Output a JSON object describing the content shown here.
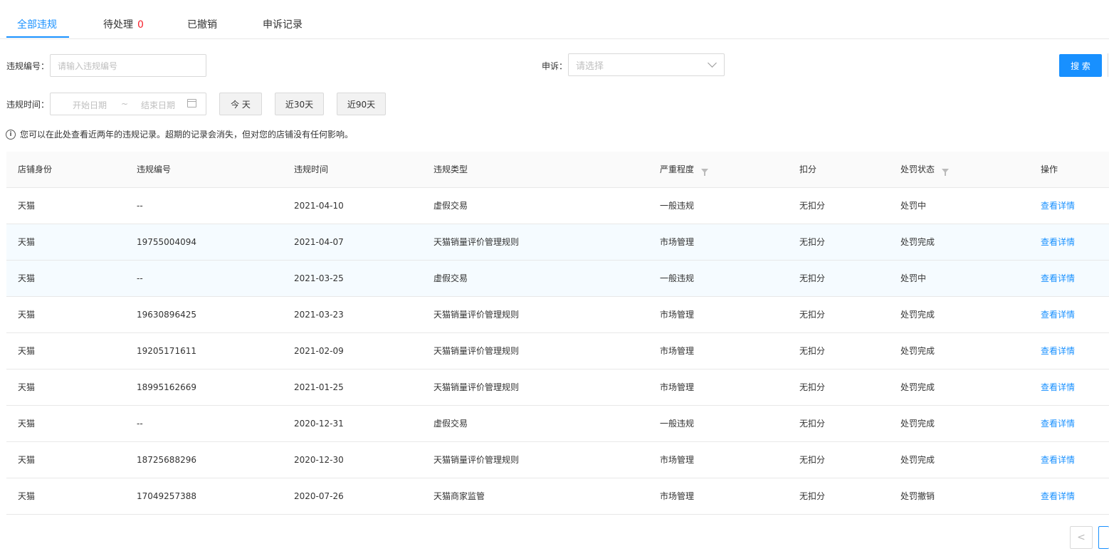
{
  "tabs": [
    {
      "label": "全部违规",
      "active": true
    },
    {
      "label": "待处理",
      "count": "0"
    },
    {
      "label": "已撤销"
    },
    {
      "label": "申诉记录"
    }
  ],
  "filters": {
    "violation_no_label": "违规编号：",
    "violation_no_placeholder": "请输入违规编号",
    "appeal_label": "申诉：",
    "appeal_placeholder": "请选择",
    "search_button": "搜 索",
    "time_label": "违规时间：",
    "start_date_placeholder": "开始日期",
    "range_separator": "~",
    "end_date_placeholder": "结束日期",
    "quick_today": "今 天",
    "quick_30": "近30天",
    "quick_90": "近90天"
  },
  "notice": "您可以在此处查看近两年的违规记录。超期的记录会消失，但对您的店铺没有任何影响。",
  "table": {
    "headers": [
      "店铺身份",
      "违规编号",
      "违规时间",
      "违规类型",
      "严重程度",
      "扣分",
      "处罚状态",
      "操作"
    ],
    "rows": [
      [
        "天猫",
        "--",
        "2021-04-10",
        "虚假交易",
        "一般违规",
        "无扣分",
        "处罚中",
        "查看详情"
      ],
      [
        "天猫",
        "19755004094",
        "2021-04-07",
        "天猫销量评价管理规则",
        "市场管理",
        "无扣分",
        "处罚完成",
        "查看详情"
      ],
      [
        "天猫",
        "--",
        "2021-03-25",
        "虚假交易",
        "一般违规",
        "无扣分",
        "处罚中",
        "查看详情"
      ],
      [
        "天猫",
        "19630896425",
        "2021-03-23",
        "天猫销量评价管理规则",
        "市场管理",
        "无扣分",
        "处罚完成",
        "查看详情"
      ],
      [
        "天猫",
        "19205171611",
        "2021-02-09",
        "天猫销量评价管理规则",
        "市场管理",
        "无扣分",
        "处罚完成",
        "查看详情"
      ],
      [
        "天猫",
        "18995162669",
        "2021-01-25",
        "天猫销量评价管理规则",
        "市场管理",
        "无扣分",
        "处罚完成",
        "查看详情"
      ],
      [
        "天猫",
        "--",
        "2020-12-31",
        "虚假交易",
        "一般违规",
        "无扣分",
        "处罚完成",
        "查看详情"
      ],
      [
        "天猫",
        "18725688296",
        "2020-12-30",
        "天猫销量评价管理规则",
        "市场管理",
        "无扣分",
        "处罚完成",
        "查看详情"
      ],
      [
        "天猫",
        "17049257388",
        "2020-07-26",
        "天猫商家监管",
        "市场管理",
        "无扣分",
        "处罚撤销",
        "查看详情"
      ]
    ]
  },
  "pagination": {
    "prev": "<",
    "next": ">"
  },
  "colors": {
    "primary": "#1890ff",
    "danger": "#f5222d"
  }
}
